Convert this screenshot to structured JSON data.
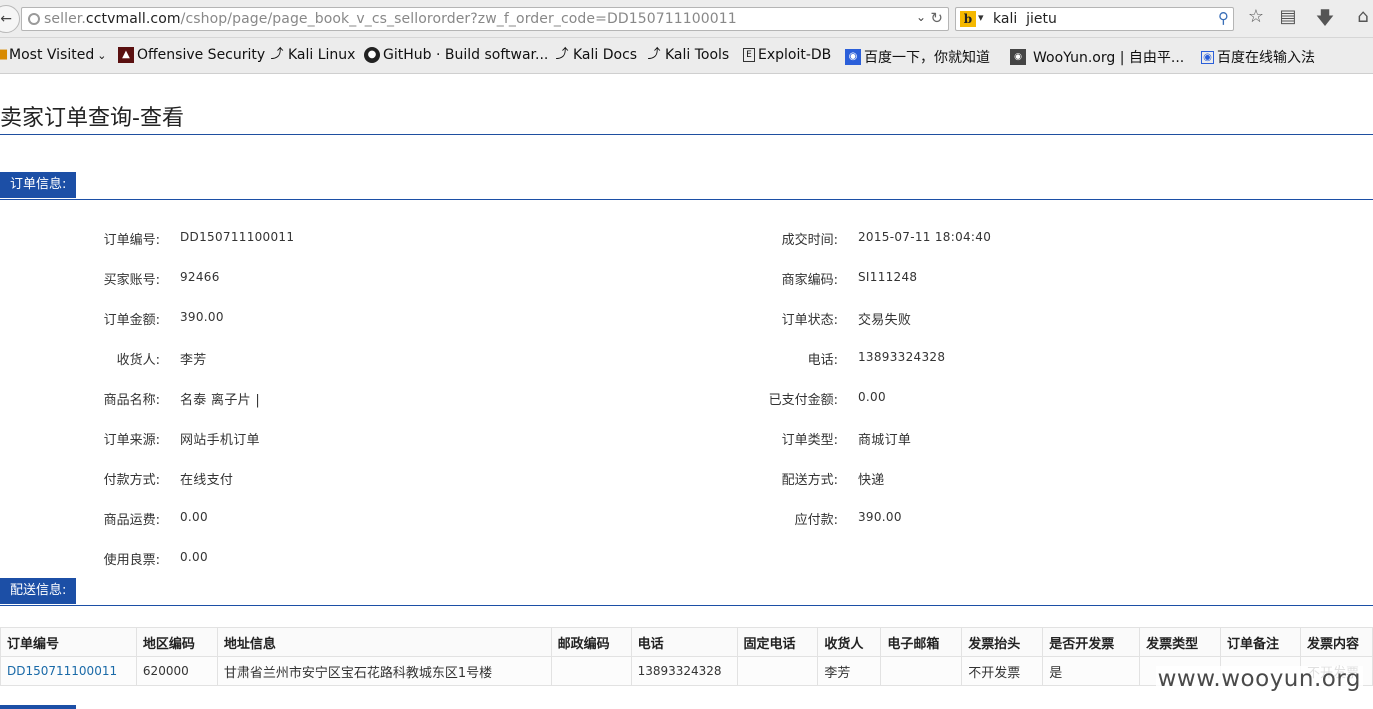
{
  "browser": {
    "url_prefix": "seller.",
    "url_domain": "cctvmall.com",
    "url_path": "/cshop/page/page_book_v_cs_sellororder?zw_f_order_code=DD150711100011",
    "search_query": "kali  jietu",
    "search_engine_letter": "b"
  },
  "bookmarks": [
    {
      "label": "Most Visited",
      "icon": "dropdown-chevron"
    },
    {
      "label": "Offensive Security",
      "icon": "offsec-icon"
    },
    {
      "label": "Kali Linux",
      "icon": "kali-dragon-icon"
    },
    {
      "label": "GitHub · Build softwar...",
      "icon": "github-icon"
    },
    {
      "label": "Kali Docs",
      "icon": "kali-dragon-icon"
    },
    {
      "label": "Kali Tools",
      "icon": "kali-dragon-icon"
    },
    {
      "label": "Exploit-DB",
      "icon": "exploitdb-icon"
    },
    {
      "label": "百度一下，你就知道",
      "icon": "baidu-icon"
    },
    {
      "label": "WooYun.org | 自由平...",
      "icon": "wooyun-icon"
    },
    {
      "label": "百度在线输入法",
      "icon": "baidu-ime-icon"
    }
  ],
  "page": {
    "title": "卖家订单查询-查看",
    "order_section_label": "订单信息:",
    "delivery_section_label": "配送信息:"
  },
  "order_left": [
    {
      "label": "订单编号:",
      "value": "DD150711100011"
    },
    {
      "label": "买家账号:",
      "value": "92466"
    },
    {
      "label": "订单金额:",
      "value": "390.00"
    },
    {
      "label": "收货人:",
      "value": "李芳"
    },
    {
      "label": "商品名称:",
      "value": "名泰 离子片 |"
    },
    {
      "label": "订单来源:",
      "value": "网站手机订单"
    },
    {
      "label": "付款方式:",
      "value": "在线支付"
    },
    {
      "label": "商品运费:",
      "value": "0.00"
    },
    {
      "label": "使用良票:",
      "value": "0.00"
    }
  ],
  "order_right": [
    {
      "label": "成交时间:",
      "value": "2015-07-11 18:04:40"
    },
    {
      "label": "商家编码:",
      "value": "SI111248"
    },
    {
      "label": "订单状态:",
      "value": "交易失败"
    },
    {
      "label": "电话:",
      "value": "13893324328"
    },
    {
      "label": "已支付金额:",
      "value": "0.00"
    },
    {
      "label": "订单类型:",
      "value": "商城订单"
    },
    {
      "label": "配送方式:",
      "value": "快递"
    },
    {
      "label": "应付款:",
      "value": "390.00"
    }
  ],
  "delivery_table": {
    "headers": [
      "订单编号",
      "地区编码",
      "地址信息",
      "邮政编码",
      "电话",
      "固定电话",
      "收货人",
      "电子邮箱",
      "发票抬头",
      "是否开发票",
      "发票类型",
      "订单备注",
      "发票内容"
    ],
    "row": [
      "DD150711100011",
      "620000",
      "甘肃省兰州市安宁区宝石花路科教城东区1号楼",
      "",
      "13893324328",
      "",
      "李芳",
      "",
      "不开发票",
      "是",
      "",
      "",
      "不开发票"
    ]
  },
  "watermark": "www.wooyun.org",
  "colors": {
    "accent": "#1c4fa6",
    "link": "#1a6aa8"
  }
}
